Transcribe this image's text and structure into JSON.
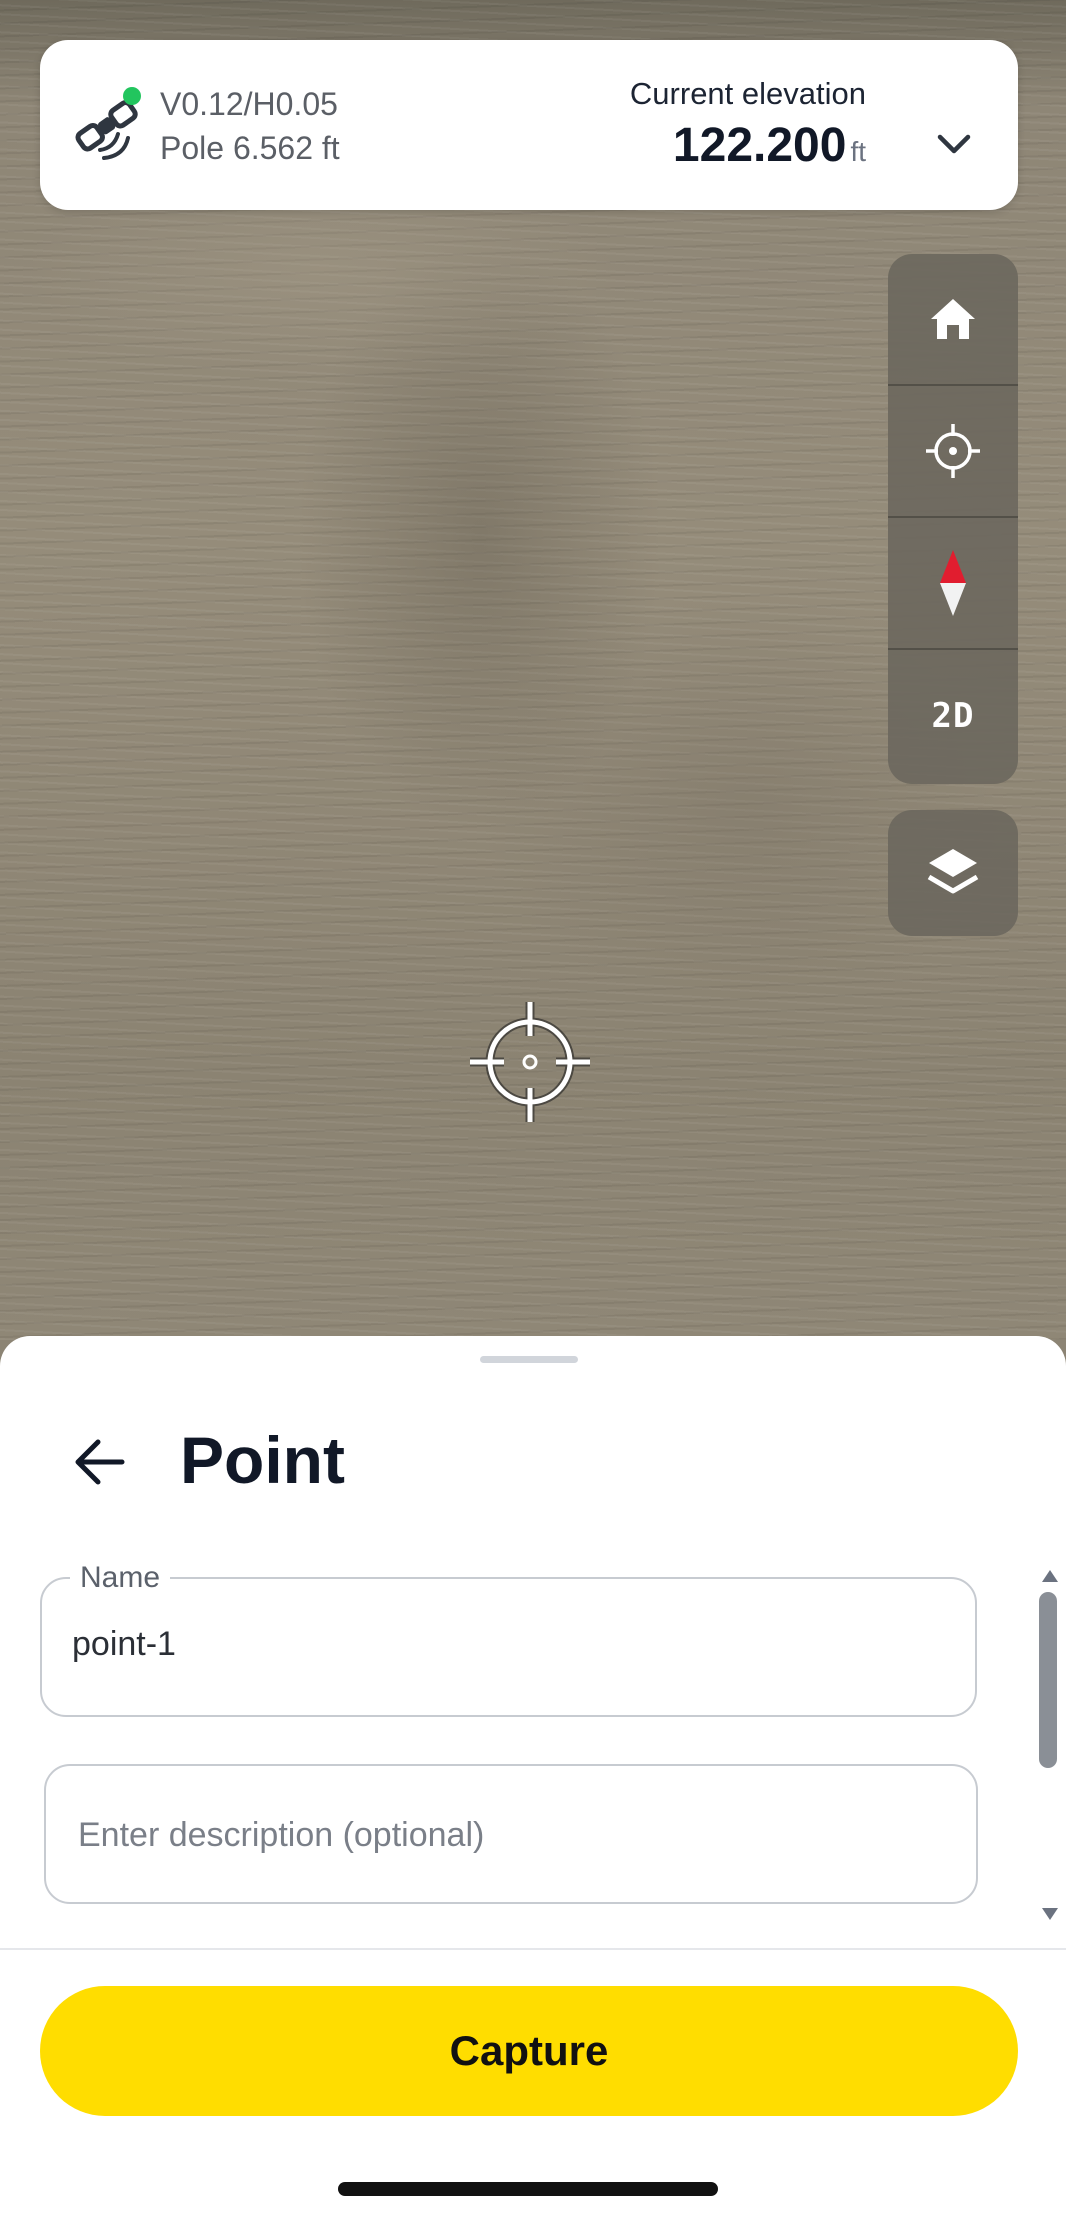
{
  "status": {
    "precision": "V0.12/H0.05",
    "pole": "Pole 6.562 ft",
    "connection_status_color": "#22c55e",
    "icon": "satellite-icon"
  },
  "elevation": {
    "label": "Current elevation",
    "value": "122.200",
    "unit": "ft",
    "expand_icon": "chevron-down-icon"
  },
  "map_tools": {
    "items": [
      {
        "name": "home",
        "icon": "home-icon"
      },
      {
        "name": "locate",
        "icon": "crosshair-icon"
      },
      {
        "name": "compass",
        "icon": "compass-icon"
      },
      {
        "name": "view-mode",
        "label": "2D"
      }
    ],
    "layers_icon": "layers-icon"
  },
  "sheet": {
    "title": "Point",
    "back_icon": "arrow-left-icon",
    "name_field": {
      "label": "Name",
      "value": "point-1"
    },
    "description_field": {
      "value": "",
      "placeholder": "Enter description (optional)"
    },
    "capture_label": "Capture"
  },
  "colors": {
    "accent": "#ffdd00",
    "compass_red": "#e11d2f"
  }
}
